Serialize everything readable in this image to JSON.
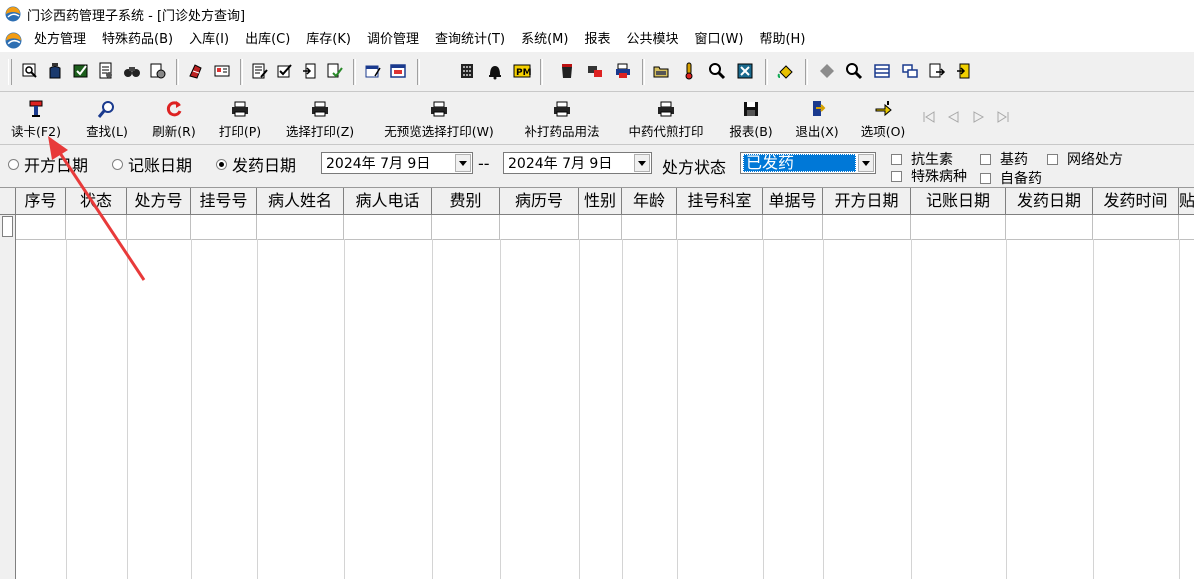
{
  "window": {
    "title": "门诊西药管理子系统 - [门诊处方查询]"
  },
  "menu": [
    "处方管理",
    "特殊药品(B)",
    "入库(I)",
    "出库(C)",
    "库存(K)",
    "调价管理",
    "查询统计(T)",
    "系统(M)",
    "报表",
    "公共模块",
    "窗口(W)",
    "帮助(H)"
  ],
  "toolbar_icons": [
    "print-preview-icon",
    "medicine-bottle-icon",
    "check-box-icon",
    "document-stamp-icon",
    "binoculars-icon",
    "settings-doc-icon",
    "drug-tag-icon",
    "card-icon",
    "list-edit-icon",
    "check-list-icon",
    "exit-door-icon",
    "doc-check-icon",
    "form-edit-icon",
    "window-icon",
    "calculator-icon",
    "bell-icon",
    "pm-icon",
    "trash-icon",
    "stamp-icon",
    "printer-icon",
    "folder-icon",
    "thermometer-icon",
    "magnifier-icon",
    "close-box-icon",
    "paint-bucket-icon",
    "gray-circle-icon",
    "search-icon",
    "list-icon",
    "window-split-icon",
    "doc-arrow-icon",
    "exit-icon"
  ],
  "actions": {
    "read_card": "读卡(F2)",
    "find": "查找(L)",
    "refresh": "刷新(R)",
    "print": "打印(P)",
    "select_print": "选择打印(Z)",
    "no_preview_print": "无预览选择打印(W)",
    "reprint_usage": "补打药品用法",
    "herbal_print": "中药代煎打印",
    "report": "报表(B)",
    "exit": "退出(X)",
    "options": "选项(O)"
  },
  "filters": {
    "date_types": [
      {
        "label": "开方日期",
        "selected": false
      },
      {
        "label": "记账日期",
        "selected": false
      },
      {
        "label": "发药日期",
        "selected": true
      }
    ],
    "date_from": "2024年 7月 9日",
    "separator": "--",
    "date_to": "2024年 7月 9日",
    "status_label": "处方状态",
    "status_value": "已发药",
    "checkboxes": [
      "抗生素",
      "基药",
      "网络处方",
      "特殊病种",
      "自备药"
    ]
  },
  "grid": {
    "columns": [
      "序号",
      "状态",
      "处方号",
      "挂号号",
      "病人姓名",
      "病人电话",
      "费别",
      "病历号",
      "性别",
      "年龄",
      "挂号科室",
      "单据号",
      "开方日期",
      "记账日期",
      "发药日期",
      "发药时间",
      "贴"
    ]
  },
  "colors": {
    "selection": "#0078d7",
    "annotation_arrow": "#e83a3a"
  }
}
